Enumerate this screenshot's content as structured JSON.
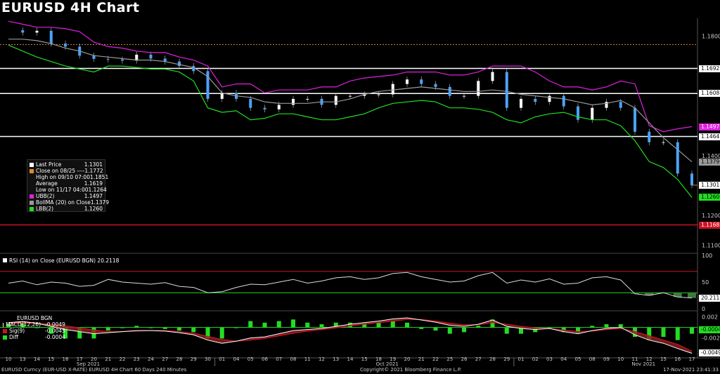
{
  "title": "EURUSD 4H Chart",
  "colors": {
    "price": "#4aa3ff",
    "upper": "#e020e0",
    "lower": "#22dd22",
    "middle": "#9a9a9a",
    "hline": "#ffffff",
    "red": "#cc1122",
    "orange": "#d08030"
  },
  "legend": [
    {
      "label": "Last Price",
      "value": "1.1301",
      "color": "#ffffff"
    },
    {
      "label": "Close on 08/25 ----",
      "value": "1.1772",
      "color": "#e08a2a"
    },
    {
      "label": "High on 09/10 07:00",
      "value": "1.1851",
      "color": ""
    },
    {
      "label": "Average",
      "value": "1.1619",
      "color": ""
    },
    {
      "label": "Low on 11/17 04:00",
      "value": "1.1264",
      "color": ""
    },
    {
      "label": "UBB(2)",
      "value": "1.1497",
      "color": "#e020e0"
    },
    {
      "label": "BollMA (20)  on Close",
      "value": "1.1379",
      "color": "#9a9a9a"
    },
    {
      "label": "LBB(2)",
      "value": "1.1260",
      "color": "#22dd22"
    }
  ],
  "rsi_legend": {
    "label": "RSI (14)  on Close (EURUSD BGN)",
    "value": "20.2118"
  },
  "macd_legend": {
    "header": "EURUSD BGN",
    "rows": [
      {
        "label": "MACD(12,26)",
        "value": "-0.0049",
        "color": "#ffffff"
      },
      {
        "label": "Sig(9)",
        "value": "-0.0045",
        "color": "#cc1122"
      },
      {
        "label": "Diff",
        "value": "-0.0004",
        "color": "#22dd22"
      }
    ]
  },
  "price_axis": [
    "1.1800",
    "1.1400",
    "1.1200",
    "1.1100"
  ],
  "price_tags": [
    {
      "text": "1.1692",
      "bg": "#ffffff",
      "fg": "#000"
    },
    {
      "text": "1.1608",
      "bg": "#ffffff",
      "fg": "#000"
    },
    {
      "text": "1.1497",
      "bg": "#e020e0",
      "fg": "#fff"
    },
    {
      "text": "1.1464",
      "bg": "#ffffff",
      "fg": "#000"
    },
    {
      "text": "1.1379",
      "bg": "#9a9a9a",
      "fg": "#000"
    },
    {
      "text": "1.1301",
      "bg": "#ffffff",
      "fg": "#000"
    },
    {
      "text": "1.1260",
      "bg": "#22dd22",
      "fg": "#000"
    },
    {
      "text": "1.1168",
      "bg": "#cc1122",
      "fg": "#fff"
    }
  ],
  "rsi_axis": [
    "100",
    "50",
    "0"
  ],
  "rsi_tag": "20.2118",
  "macd_axis": [
    "0.002",
    "-0.002"
  ],
  "macd_tags": [
    "-0.0004",
    "-0.0049"
  ],
  "x_days": [
    "10",
    "13",
    "14",
    "15",
    "16",
    "17",
    "20",
    "21",
    "22",
    "23",
    "24",
    "27",
    "28",
    "29",
    "30",
    "01",
    "04",
    "05",
    "06",
    "07",
    "08",
    "11",
    "12",
    "13",
    "14",
    "15",
    "18",
    "19",
    "20",
    "21",
    "22",
    "25",
    "26",
    "27",
    "28",
    "29",
    "01",
    "02",
    "03",
    "04",
    "05",
    "08",
    "09",
    "10",
    "11",
    "12",
    "15",
    "16",
    "17"
  ],
  "x_months": [
    "Sep 2021",
    "Oct 2021",
    "Nov 2021"
  ],
  "footer": {
    "left": "EURUSD Curncy (EUR-USD X-RATE) EURUSD 4H Chart 60 Days 240 Minutes",
    "center": "Copyright© 2021 Bloomberg Finance L.P.",
    "right": "17-Nov-2021 23:41:33"
  },
  "chart_data": {
    "type": "line",
    "title": "EURUSD 4H Chart",
    "x": [
      "10",
      "13",
      "14",
      "15",
      "16",
      "17",
      "20",
      "21",
      "22",
      "23",
      "24",
      "27",
      "28",
      "29",
      "30",
      "01",
      "04",
      "05",
      "06",
      "07",
      "08",
      "11",
      "12",
      "13",
      "14",
      "15",
      "18",
      "19",
      "20",
      "21",
      "22",
      "25",
      "26",
      "27",
      "28",
      "29",
      "01",
      "02",
      "03",
      "04",
      "05",
      "08",
      "09",
      "10",
      "11",
      "12",
      "15",
      "16",
      "17"
    ],
    "series": [
      {
        "name": "Last Price",
        "values": [
          1.182,
          1.1812,
          1.1818,
          1.1775,
          1.1765,
          1.1735,
          1.1724,
          1.1722,
          1.1718,
          1.1738,
          1.1725,
          1.1715,
          1.17,
          1.1683,
          1.159,
          1.161,
          1.159,
          1.156,
          1.1555,
          1.157,
          1.159,
          1.159,
          1.157,
          1.16,
          1.16,
          1.1605,
          1.1605,
          1.164,
          1.1655,
          1.164,
          1.163,
          1.16,
          1.16,
          1.165,
          1.168,
          1.156,
          1.159,
          1.158,
          1.16,
          1.1565,
          1.152,
          1.156,
          1.158,
          1.156,
          1.148,
          1.1445,
          1.1445,
          1.134,
          1.1301
        ]
      },
      {
        "name": "UBB(2)",
        "values": [
          1.185,
          1.184,
          1.183,
          1.183,
          1.1825,
          1.1815,
          1.178,
          1.1765,
          1.176,
          1.175,
          1.1745,
          1.1745,
          1.173,
          1.172,
          1.17,
          1.163,
          1.164,
          1.164,
          1.161,
          1.162,
          1.162,
          1.162,
          1.163,
          1.163,
          1.165,
          1.166,
          1.1665,
          1.167,
          1.168,
          1.168,
          1.168,
          1.167,
          1.167,
          1.168,
          1.17,
          1.17,
          1.17,
          1.168,
          1.165,
          1.163,
          1.163,
          1.162,
          1.163,
          1.165,
          1.164,
          1.15,
          1.148,
          1.149,
          1.1497
        ]
      },
      {
        "name": "BollMA (20)  on Close",
        "values": [
          1.179,
          1.179,
          1.1785,
          1.1775,
          1.176,
          1.175,
          1.1735,
          1.173,
          1.1725,
          1.172,
          1.172,
          1.1715,
          1.1705,
          1.1695,
          1.1665,
          1.161,
          1.16,
          1.1595,
          1.158,
          1.1575,
          1.1575,
          1.1575,
          1.158,
          1.158,
          1.159,
          1.1605,
          1.1615,
          1.162,
          1.1625,
          1.163,
          1.1625,
          1.162,
          1.1615,
          1.1615,
          1.162,
          1.1615,
          1.1605,
          1.16,
          1.1595,
          1.159,
          1.158,
          1.157,
          1.1575,
          1.1585,
          1.156,
          1.151,
          1.146,
          1.142,
          1.1379
        ]
      },
      {
        "name": "LBB(2)",
        "values": [
          1.177,
          1.175,
          1.173,
          1.1715,
          1.17,
          1.169,
          1.168,
          1.17,
          1.17,
          1.1695,
          1.169,
          1.169,
          1.168,
          1.165,
          1.156,
          1.1545,
          1.155,
          1.152,
          1.1525,
          1.154,
          1.154,
          1.153,
          1.152,
          1.152,
          1.153,
          1.154,
          1.156,
          1.1575,
          1.158,
          1.1585,
          1.158,
          1.156,
          1.156,
          1.1555,
          1.1545,
          1.152,
          1.151,
          1.153,
          1.154,
          1.1545,
          1.153,
          1.152,
          1.152,
          1.15,
          1.145,
          1.138,
          1.136,
          1.132,
          1.126
        ]
      }
    ],
    "hlines": [
      1.1772,
      1.1692,
      1.1608,
      1.1464,
      1.1168
    ],
    "ylim": [
      1.108,
      1.186
    ],
    "rsi": {
      "values": [
        48,
        52,
        45,
        50,
        48,
        42,
        44,
        55,
        50,
        48,
        46,
        49,
        42,
        40,
        30,
        32,
        40,
        46,
        45,
        50,
        55,
        48,
        52,
        58,
        60,
        55,
        58,
        66,
        68,
        60,
        55,
        50,
        52,
        62,
        68,
        48,
        54,
        50,
        56,
        46,
        48,
        58,
        60,
        54,
        28,
        25,
        30,
        22,
        20.2118
      ],
      "levels": [
        70,
        30
      ],
      "ylim": [
        0,
        100
      ]
    },
    "macd": {
      "macd": [
        0.0009,
        0.0011,
        0.0008,
        0.0002,
        -0.0004,
        -0.0008,
        -0.0012,
        -0.001,
        -0.0008,
        -0.0006,
        -0.0006,
        -0.0007,
        -0.001,
        -0.0014,
        -0.0024,
        -0.003,
        -0.0026,
        -0.002,
        -0.0018,
        -0.0012,
        -0.0006,
        -0.0004,
        -0.0002,
        0.0002,
        0.0006,
        0.0009,
        0.0012,
        0.0016,
        0.0018,
        0.0014,
        0.001,
        0.0004,
        0.0002,
        0.0006,
        0.0014,
        0.0002,
        -0.0002,
        -0.0004,
        -0.0002,
        -0.0008,
        -0.0012,
        -0.0006,
        -0.0002,
        0.0,
        -0.0014,
        -0.0024,
        -0.003,
        -0.004,
        -0.0049
      ],
      "signal": [
        0.0007,
        0.0008,
        0.0008,
        0.0006,
        0.0003,
        -0.0001,
        -0.0005,
        -0.0008,
        -0.0008,
        -0.0007,
        -0.0006,
        -0.0006,
        -0.0008,
        -0.0011,
        -0.0017,
        -0.0023,
        -0.0026,
        -0.0024,
        -0.0021,
        -0.0016,
        -0.0011,
        -0.0007,
        -0.0004,
        -0.0001,
        0.0003,
        0.0006,
        0.0009,
        0.0012,
        0.0015,
        0.0015,
        0.0012,
        0.0008,
        0.0005,
        0.0005,
        0.0009,
        0.0006,
        0.0002,
        -0.0001,
        -0.0002,
        -0.0005,
        -0.0008,
        -0.0007,
        -0.0004,
        -0.0002,
        -0.0008,
        -0.0016,
        -0.0024,
        -0.0032,
        -0.0045
      ],
      "ylim": [
        -0.0055,
        0.003
      ]
    }
  }
}
